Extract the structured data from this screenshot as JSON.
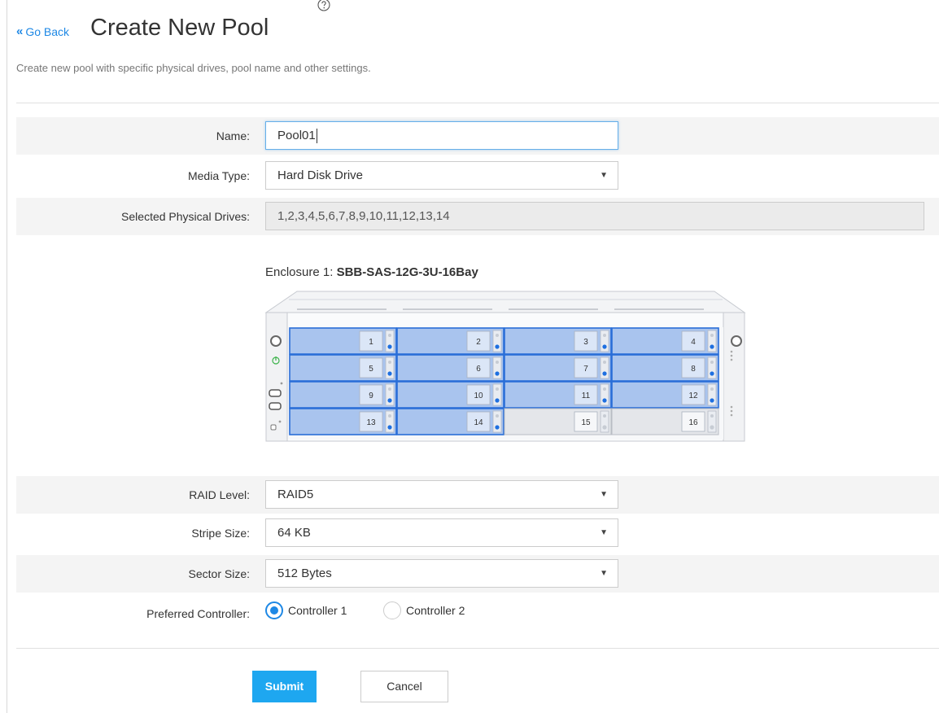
{
  "header": {
    "go_back_label": "Go Back",
    "title": "Create New Pool",
    "subtitle": "Create new pool with specific physical drives, pool name and other settings."
  },
  "form": {
    "name": {
      "label": "Name:",
      "value": "Pool01"
    },
    "media_type": {
      "label": "Media Type:",
      "value": "Hard Disk Drive"
    },
    "selected_drives": {
      "label": "Selected Physical Drives:",
      "value": "1,2,3,4,5,6,7,8,9,10,11,12,13,14"
    },
    "raid_level": {
      "label": "RAID Level:",
      "value": "RAID5"
    },
    "stripe_size": {
      "label": "Stripe Size:",
      "value": "64 KB"
    },
    "sector_size": {
      "label": "Sector Size:",
      "value": "512 Bytes"
    },
    "preferred_controller": {
      "label": "Preferred Controller:",
      "options": [
        "Controller 1",
        "Controller 2"
      ],
      "selected": "Controller 1"
    }
  },
  "enclosure": {
    "prefix": "Enclosure 1:",
    "model": "SBB-SAS-12G-3U-16Bay",
    "bays": [
      {
        "number": "1",
        "selected": true
      },
      {
        "number": "2",
        "selected": true
      },
      {
        "number": "3",
        "selected": true
      },
      {
        "number": "4",
        "selected": true
      },
      {
        "number": "5",
        "selected": true
      },
      {
        "number": "6",
        "selected": true
      },
      {
        "number": "7",
        "selected": true
      },
      {
        "number": "8",
        "selected": true
      },
      {
        "number": "9",
        "selected": true
      },
      {
        "number": "10",
        "selected": true
      },
      {
        "number": "11",
        "selected": true
      },
      {
        "number": "12",
        "selected": true
      },
      {
        "number": "13",
        "selected": true
      },
      {
        "number": "14",
        "selected": true
      },
      {
        "number": "15",
        "selected": false
      },
      {
        "number": "16",
        "selected": false
      }
    ],
    "colors": {
      "selected_bay": "#a9c4ee",
      "selected_border": "#2a6ed8",
      "empty_bay": "#e4e6ea",
      "led": "#1e6fe0"
    }
  },
  "buttons": {
    "submit_label": "Submit",
    "cancel_label": "Cancel"
  },
  "colors": {
    "accent": "#1e88e5",
    "submit": "#1ea7f0"
  }
}
